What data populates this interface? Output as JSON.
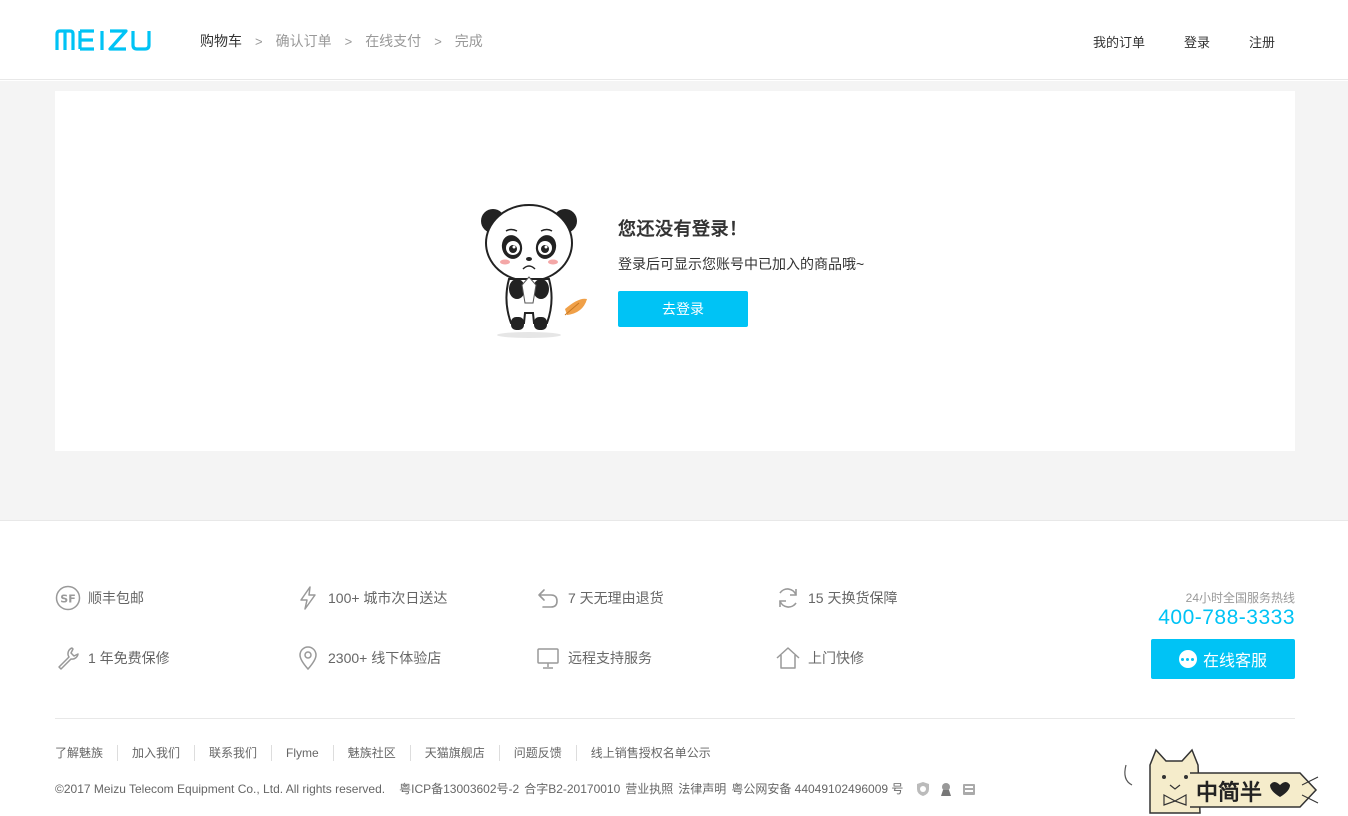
{
  "header": {
    "logo_text": "MEIZU",
    "breadcrumb": [
      "购物车",
      "确认订单",
      "在线支付",
      "完成"
    ],
    "breadcrumb_sep": ">",
    "nav": [
      "我的订单",
      "登录",
      "注册"
    ]
  },
  "empty": {
    "title": "您还没有登录！",
    "desc": "登录后可显示您账号中已加入的商品哦~",
    "button": "去登录"
  },
  "services": [
    {
      "icon": "sf-express-icon",
      "label": "顺丰包邮"
    },
    {
      "icon": "lightning-icon",
      "label": "100+ 城市次日送达"
    },
    {
      "icon": "return-icon",
      "label": "7 天无理由退货"
    },
    {
      "icon": "refresh-icon",
      "label": "15 天换货保障"
    },
    {
      "icon": "wrench-icon",
      "label": "1 年免费保修"
    },
    {
      "icon": "location-pin-icon",
      "label": "2300+ 线下体验店"
    },
    {
      "icon": "monitor-icon",
      "label": "远程支持服务"
    },
    {
      "icon": "home-icon",
      "label": "上门快修"
    }
  ],
  "hotline": {
    "label": "24小时全国服务热线",
    "number": "400-788-3333",
    "cs_button": "在线客服"
  },
  "footer": {
    "links": [
      "了解魅族",
      "加入我们",
      "联系我们",
      "Flyme",
      "魅族社区",
      "天猫旗舰店",
      "问题反馈",
      "线上销售授权名单公示"
    ],
    "copyright": "©2017 Meizu Telecom Equipment Co., Ltd. All rights reserved.",
    "icp": "粤ICP备13003602号-2",
    "license": "合字B2-20170010",
    "business": "营业执照",
    "legal": "法律声明",
    "police": "粤公网安备 44049102496009 号"
  },
  "watermark": "中简半",
  "colors": {
    "accent": "#00c3f5",
    "bg": "#f4f4f4"
  }
}
